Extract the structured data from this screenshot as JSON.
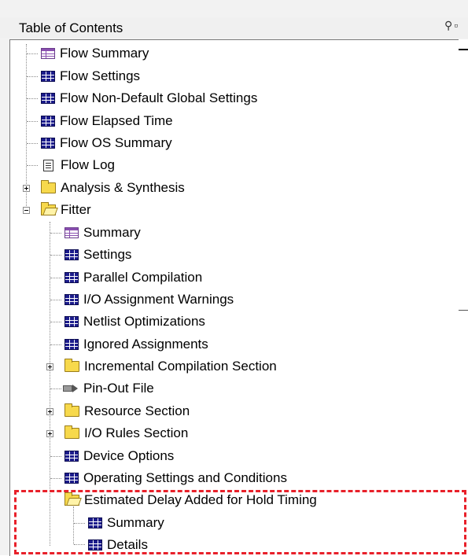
{
  "panel": {
    "title": "Table of Contents"
  },
  "tree": {
    "flow_summary": "Flow Summary",
    "flow_settings": "Flow Settings",
    "flow_non_default": "Flow Non-Default Global Settings",
    "flow_elapsed": "Flow Elapsed Time",
    "flow_os_summary": "Flow OS Summary",
    "flow_log": "Flow Log",
    "analysis_synthesis": "Analysis & Synthesis",
    "fitter": "Fitter",
    "fitter_children": {
      "summary": "Summary",
      "settings": "Settings",
      "parallel": "Parallel Compilation",
      "io_warnings": "I/O Assignment Warnings",
      "netlist_opt": "Netlist Optimizations",
      "ignored": "Ignored Assignments",
      "incremental": "Incremental Compilation Section",
      "pinout": "Pin-Out File",
      "resource": "Resource Section",
      "io_rules": "I/O Rules Section",
      "device_options": "Device Options",
      "operating": "Operating Settings and Conditions",
      "estimated_delay": "Estimated Delay Added for Hold Timing",
      "estimated_children": {
        "summary": "Summary",
        "details": "Details"
      }
    }
  },
  "colors": {
    "highlight_border": "#e8202a",
    "folder": "#f7d94c",
    "table_icon": "#1c1c8c"
  }
}
